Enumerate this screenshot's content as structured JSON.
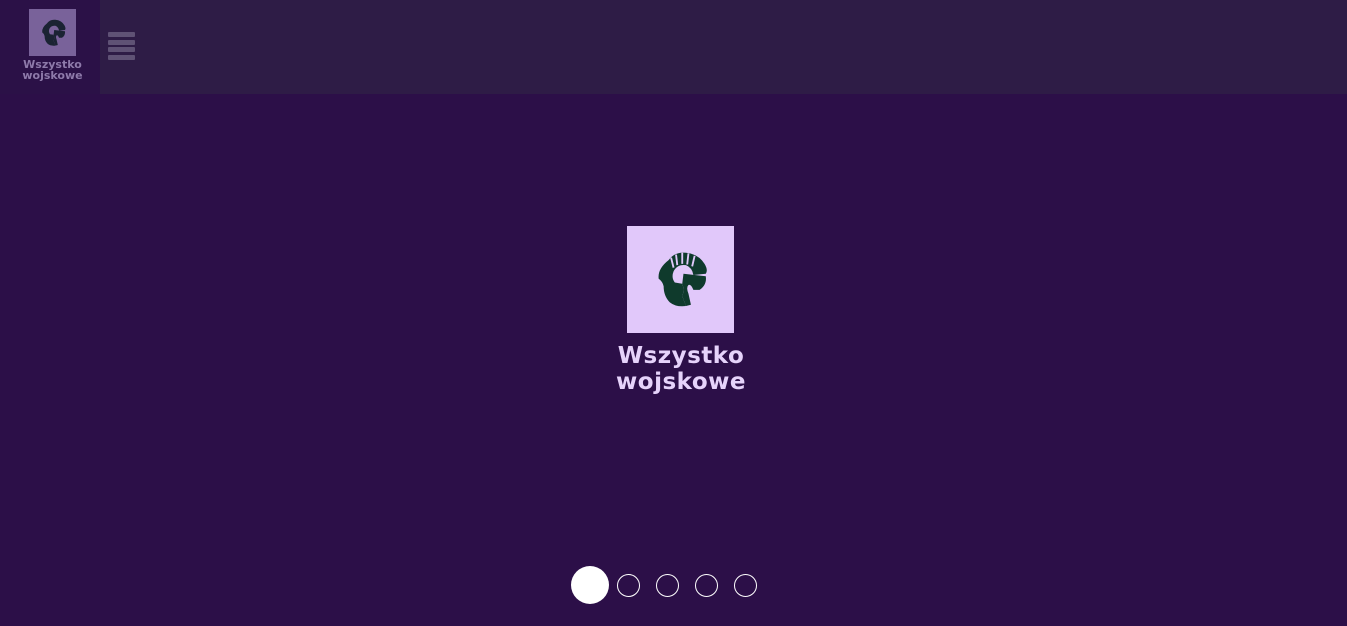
{
  "brand": {
    "name": "Wszystko\nwojskowe",
    "icon": "spartan-helmet-icon",
    "colors": {
      "background": "#2c0f48",
      "header_bar": "#2e1c46",
      "hero_box": "#e1c8fa",
      "helmet": "#0f3a2c"
    }
  },
  "header": {
    "menu_icon": "hamburger-menu-icon"
  },
  "hero": {
    "title": "Wszystko\nwojskowe"
  },
  "carousel": {
    "slides": 5,
    "active_index": 0
  }
}
